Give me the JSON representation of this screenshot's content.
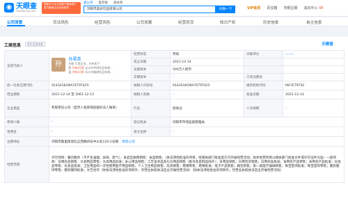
{
  "header": {
    "logo_text": "天眼查",
    "logo_sub": "TianYanCha.com",
    "promo_lines": [
      "国家中小企业发展子基金旗下",
      "官方备案企业征信机构"
    ],
    "search_tabs": [
      "查公司",
      "查老板",
      "查关系"
    ],
    "search_value": "浏阳市美砂饮品有限公司",
    "search_button": "天眼一下",
    "nav": [
      "VIP会员",
      "百宝箱",
      "天眼企服",
      "消息中心"
    ],
    "message_count": "48"
  },
  "tabs": [
    {
      "label": "公司背景",
      "count": "",
      "active": true
    },
    {
      "label": "司法风险",
      "count": ""
    },
    {
      "label": "经营风险",
      "count": ""
    },
    {
      "label": "公司发展",
      "count": ""
    },
    {
      "label": "经营状况",
      "count": ""
    },
    {
      "label": "知识产权",
      "count": ""
    },
    {
      "label": "历史信息",
      "count": ""
    },
    {
      "label": "自主信息",
      "count": ""
    }
  ],
  "section": {
    "title": "工商信息",
    "tag": "股东信息核查",
    "brand": "天眼查"
  },
  "legal": {
    "label": "法定代表人",
    "avatar_char": "孙",
    "name": "孙翠英",
    "sub1": "任职 5 家企业，分布如下",
    "row1_badge": "股",
    "row1_count": "共有41家",
    "row1_text": "长沙市芊树饮品有限...",
    "row1_tag": "股东",
    "row2_badge": "监",
    "row2_count": "共有33家",
    "row2_text": "长沙市盛湖饮品有限...",
    "row2_tag": "股东"
  },
  "fields": {
    "status_label": "经营状态",
    "status_value": "存续",
    "estdate_label": "成立日期",
    "estdate_value": "2021-12-14",
    "score_label": "天眼评分",
    "score_value": "",
    "regcap_label": "注册资本",
    "regcap_value": "500万人民币",
    "paidcap_label": "实缴资本",
    "paidcap_value": "-",
    "code_label": "工商注册号",
    "code_value": "",
    "credit_label": "统一社会信用代码",
    "credit_value": "91430181MA7ET9T425",
    "taxid_label": "纳税人识别号",
    "taxid_value": "91430181MA7ET9T425",
    "org_label": "组织机构代码",
    "org_value": "MA7ET9T42",
    "term_label": "营业期限",
    "term_value": "2021-12-14 至 2061-12-13",
    "taxqual_label": "纳税人资质",
    "taxqual_value": "-",
    "approve_label": "核准日期",
    "approve_value": "2021-12-14",
    "type_label": "企业类型",
    "type_value": "有限责任公司（自然人投资或控股的法人独资）",
    "industry_label": "行业",
    "industry_value": "批发业",
    "staff_label": "人员规模",
    "staff_value": "-",
    "insured_label": "参保人数",
    "insured_value": "-",
    "authority_label": "登记机关",
    "authority_value": "浏阳市市场监督管理局",
    "former_label": "曾用名",
    "former_value": "-",
    "en_label": "英文名称",
    "en_value": "-",
    "addr_label": "注册地址",
    "addr_value": "浏阳市集里街道北正西路四号中山北120-1号铺",
    "addr_link": "附近公司",
    "scope_label": "经营范围",
    "scope_value": "许可项目：餐饮服务（不产生油烟、异味、废气）；食品互联网销售；食品销售。（依法须经批准的项目，经相关部门批准后方可开展经营活动，具体经营项目以相关部门批准文件或许可证件为准）一般项目：日用杂品销售；文具用品零售；文具用品批发；办公用品销售；工艺美术品及礼仪用品销售（象牙及其制品除外）；日用品销售；日用百货销售；日用杂品批发；食用农产品零售；食用农产品批发；化妆品零售；化妆品批发；卫生用品和一次性使用医疗用品销售；个人卫生用品销售；玩具销售；鞋帽零售；鞋帽批发；电子产品销售；箱包销售；第一类医疗器械销售；珠宝首饰批发；珠宝首饰零售；服装服饰零售；服装服饰批发；文艺创作（除依法须经批准的项目外，凭营业执照依法自主开展经营活动）（除依法须经批准的项目外，凭营业执照依法自主开展经营活动）"
  }
}
